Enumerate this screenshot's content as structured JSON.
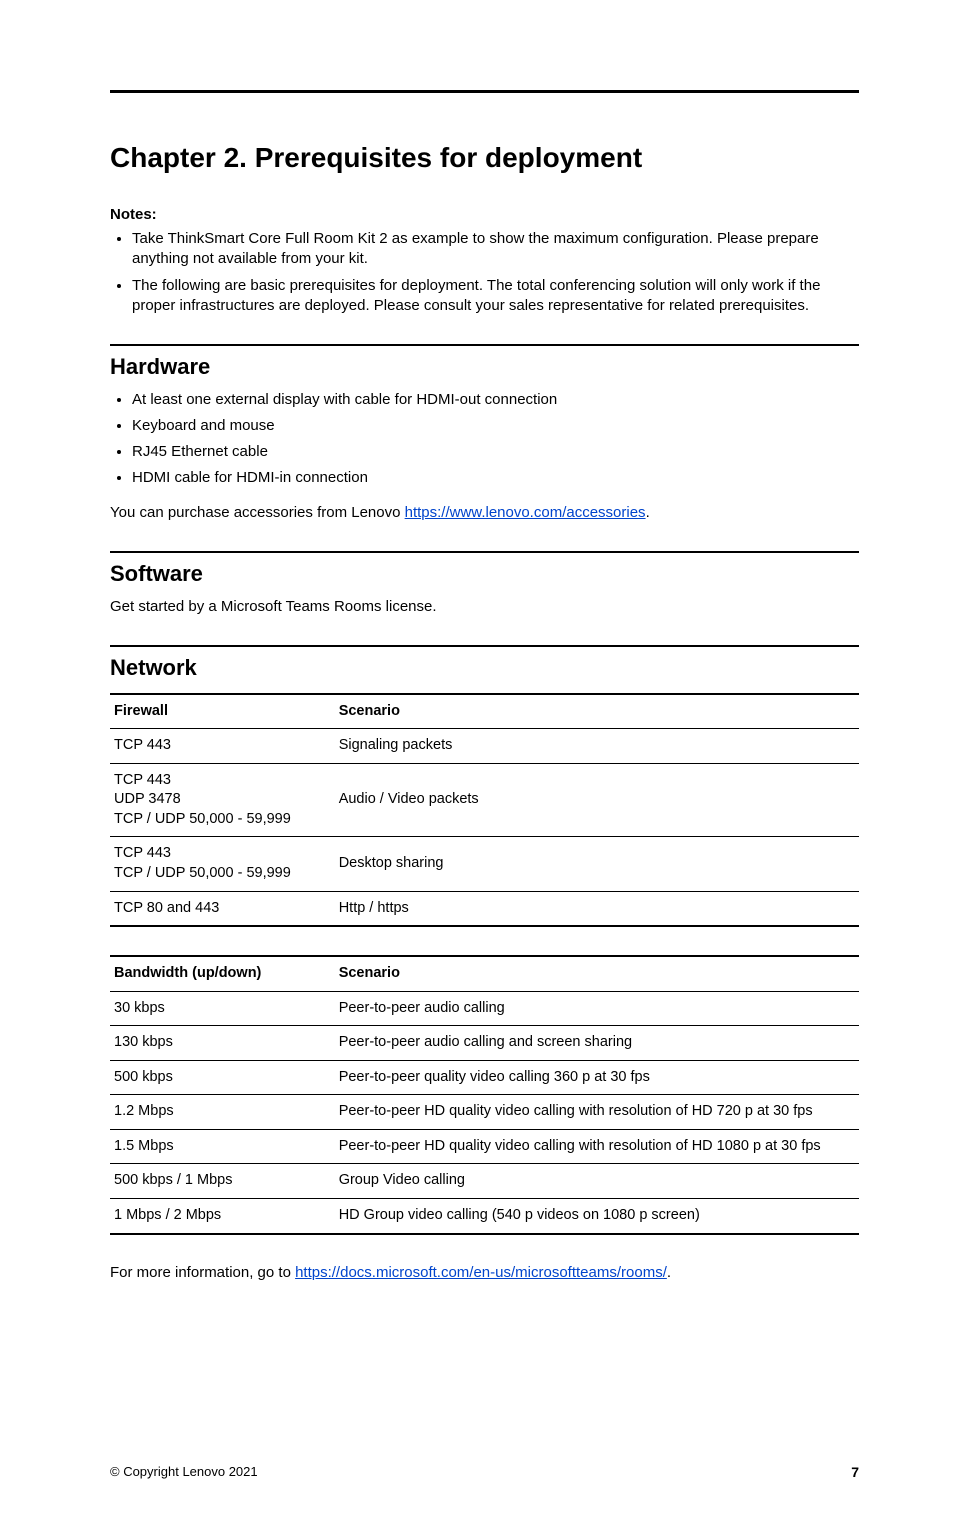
{
  "chapter_title": "Chapter 2.   Prerequisites for deployment",
  "notes_label": "Notes:",
  "notes": [
    "Take ThinkSmart Core Full Room Kit 2 as example to show the maximum configuration. Please prepare anything not available from your kit.",
    "The following are basic prerequisites for deployment. The total conferencing solution will only work if the proper infrastructures are deployed. Please consult your sales representative for related prerequisites."
  ],
  "hardware": {
    "heading": "Hardware",
    "items": [
      "At least one external display with cable for HDMI-out connection",
      "Keyboard and mouse",
      "RJ45 Ethernet cable",
      "HDMI cable for HDMI-in connection"
    ],
    "accessories_prefix": "You can purchase accessories from Lenovo ",
    "accessories_link": "https://www.lenovo.com/accessories",
    "accessories_suffix": "."
  },
  "software": {
    "heading": "Software",
    "text": "Get started by a Microsoft Teams Rooms license."
  },
  "network": {
    "heading": "Network",
    "table1": {
      "col1": "Firewall",
      "col2": "Scenario",
      "rows": [
        {
          "c1": "TCP 443",
          "c2": "Signaling packets"
        },
        {
          "c1": "TCP 443\nUDP 3478\nTCP / UDP 50,000 - 59,999",
          "c2": "Audio / Video packets"
        },
        {
          "c1": "TCP 443\nTCP / UDP 50,000 - 59,999",
          "c2": "Desktop sharing"
        },
        {
          "c1": "TCP 80 and 443",
          "c2": "Http / https"
        }
      ]
    },
    "table2": {
      "col1": "Bandwidth (up/down)",
      "col2": "Scenario",
      "rows": [
        {
          "c1": "30 kbps",
          "c2": "Peer-to-peer audio calling"
        },
        {
          "c1": "130 kbps",
          "c2": "Peer-to-peer audio calling and screen sharing"
        },
        {
          "c1": "500 kbps",
          "c2": "Peer-to-peer quality video calling 360 p at 30 fps"
        },
        {
          "c1": "1.2 Mbps",
          "c2": "Peer-to-peer HD quality video calling with resolution of HD 720 p at 30 fps"
        },
        {
          "c1": "1.5 Mbps",
          "c2": "Peer-to-peer HD quality video calling with resolution of HD 1080 p at 30 fps"
        },
        {
          "c1": "500 kbps / 1 Mbps",
          "c2": "Group Video calling"
        },
        {
          "c1": "1 Mbps / 2 Mbps",
          "c2": "HD Group video calling (540 p videos on 1080 p screen)"
        }
      ]
    },
    "more_prefix": "For more information, go to ",
    "more_link": "https://docs.microsoft.com/en-us/microsoftteams/rooms/",
    "more_suffix": "."
  },
  "footer": {
    "copyright": "© Copyright Lenovo 2021",
    "page": "7"
  }
}
